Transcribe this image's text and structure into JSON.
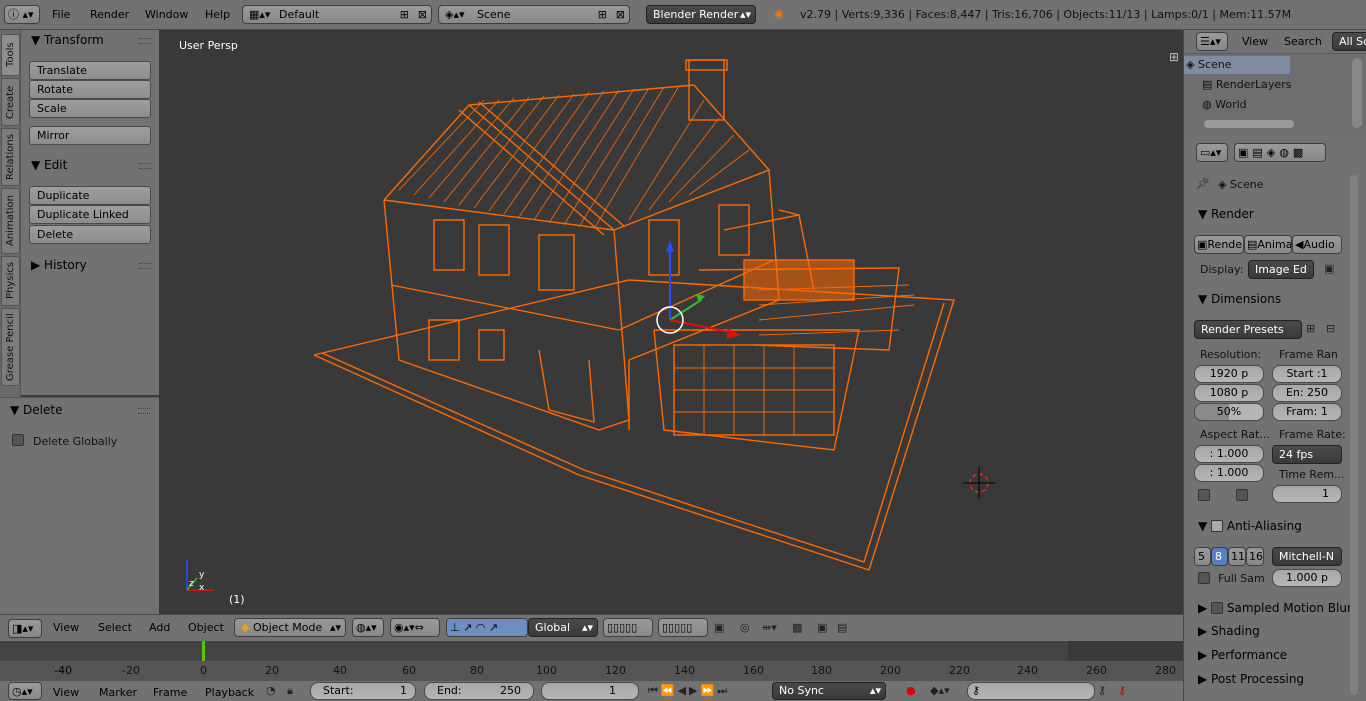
{
  "topbar": {
    "menus": [
      "File",
      "Render",
      "Window",
      "Help"
    ],
    "layout": "Default",
    "scene": "Scene",
    "engine": "Blender Render",
    "stats": "v2.79 | Verts:9,336 | Faces:8,447 | Tris:16,706 | Objects:11/13 | Lamps:0/1 | Mem:11.57M"
  },
  "tool_tabs": [
    "Tools",
    "Create",
    "Relations",
    "Animation",
    "Physics",
    "Grease Pencil"
  ],
  "tools": {
    "transform_title": "Transform",
    "translate": "Translate",
    "rotate": "Rotate",
    "scale": "Scale",
    "mirror": "Mirror",
    "edit_title": "Edit",
    "duplicate": "Duplicate",
    "duplicate_linked": "Duplicate Linked",
    "delete": "Delete",
    "history_title": "History"
  },
  "operator": {
    "title": "Delete",
    "option": "Delete Globally"
  },
  "viewport": {
    "label": "User Persp",
    "frame": "(1)",
    "wire_color": "#ff6a00"
  },
  "vp_header": {
    "menus": [
      "View",
      "Select",
      "Add",
      "Object"
    ],
    "mode": "Object Mode",
    "orientation": "Global"
  },
  "timeline": {
    "ticks": [
      "-40",
      "-20",
      "0",
      "20",
      "40",
      "60",
      "80",
      "100",
      "120",
      "140",
      "160",
      "180",
      "200",
      "220",
      "240",
      "260",
      "280"
    ],
    "current_frame_color": "#5ac800"
  },
  "tl_header": {
    "menus": [
      "View",
      "Marker",
      "Frame",
      "Playback"
    ],
    "start_label": "Start:",
    "start_value": "1",
    "end_label": "End:",
    "end_value": "250",
    "current": "1",
    "sync": "No Sync"
  },
  "outliner": {
    "view": "View",
    "search": "Search",
    "filter": "All Sc",
    "items": [
      "Scene",
      "RenderLayers",
      "World"
    ]
  },
  "properties": {
    "context": "Scene",
    "render_title": "Render",
    "render_btn": "Rende",
    "anim_btn": "Anima",
    "audio_btn": "Audio",
    "display_label": "Display:",
    "display_value": "Image Ed",
    "dimensions_title": "Dimensions",
    "presets": "Render Presets",
    "resolution_label": "Resolution:",
    "res_x": "1920 p",
    "res_y": "1080 p",
    "res_pct": "50%",
    "frame_range_label": "Frame Ran",
    "start": "Start :1",
    "end": "En: 250",
    "step": "Fram: 1",
    "aspect_label": "Aspect Rat...",
    "aspect_x": ": 1.000",
    "aspect_y": ": 1.000",
    "frame_rate_label": "Frame Rate:",
    "fps": "24 fps",
    "time_remap_label": "Time Rem...",
    "time_remap_val": "1",
    "aa_title": "Anti-Aliasing",
    "aa_samples": [
      "5",
      "8",
      "11",
      "16"
    ],
    "aa_filter": "Mitchell-N",
    "full_sample": "Full Sam",
    "filter_size": "1.000 p",
    "smb_title": "Sampled Motion Blur",
    "shading_title": "Shading",
    "performance_title": "Performance",
    "post_title": "Post Processing"
  }
}
